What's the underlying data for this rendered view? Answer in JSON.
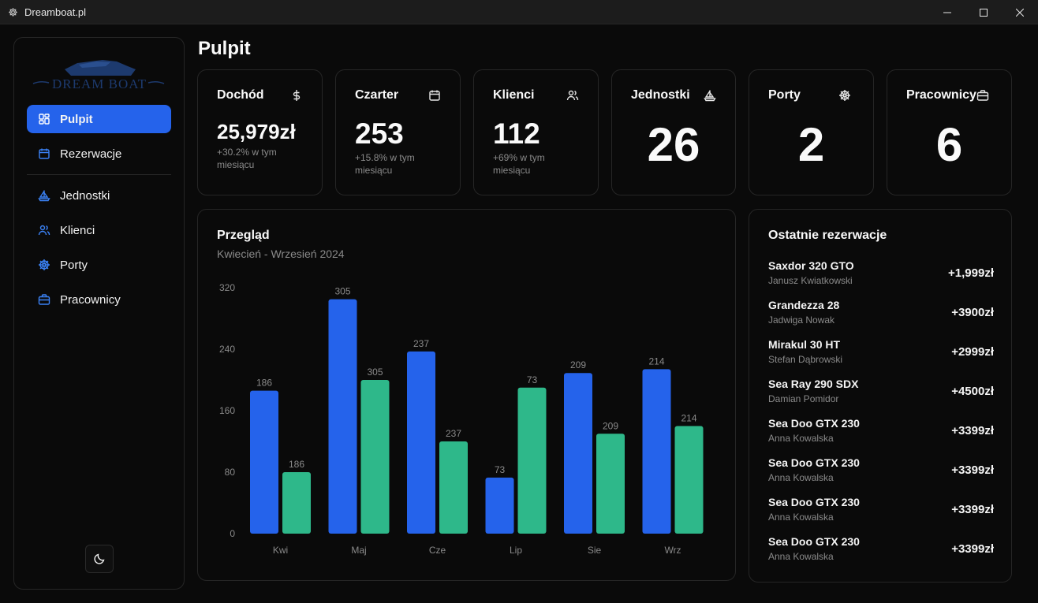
{
  "window": {
    "title": "Dreamboat.pl"
  },
  "sidebar": {
    "logo_text": "DREAM BOAT",
    "items": [
      {
        "label": "Pulpit",
        "icon": "dashboard-grid-icon",
        "active": true
      },
      {
        "label": "Rezerwacje",
        "icon": "calendar-icon",
        "active": false
      },
      {
        "label": "Jednostki",
        "icon": "sailboat-icon",
        "active": false
      },
      {
        "label": "Klienci",
        "icon": "users-icon",
        "active": false
      },
      {
        "label": "Porty",
        "icon": "ship-wheel-icon",
        "active": false
      },
      {
        "label": "Pracownicy",
        "icon": "briefcase-icon",
        "active": false
      }
    ],
    "theme_toggle_icon": "moon-icon"
  },
  "page": {
    "title": "Pulpit"
  },
  "cards": [
    {
      "title": "Dochód",
      "value": "25,979zł",
      "sub": "+30.2% w tym miesiącu",
      "icon": "dollar-icon"
    },
    {
      "title": "Czarter",
      "value": "253",
      "sub": "+15.8% w tym miesiącu",
      "icon": "calendar-icon"
    },
    {
      "title": "Klienci",
      "value": "112",
      "sub": "+69% w tym miesiącu",
      "icon": "users-icon"
    },
    {
      "title": "Jednostki",
      "value": "26",
      "icon": "sailboat-icon"
    },
    {
      "title": "Porty",
      "value": "2",
      "icon": "ship-wheel-icon"
    },
    {
      "title": "Pracownicy",
      "value": "6",
      "icon": "briefcase-icon"
    }
  ],
  "overview": {
    "title": "Przegląd",
    "subtitle": "Kwiecień - Wrzesień 2024"
  },
  "chart_data": {
    "type": "bar",
    "title": "Przegląd",
    "subtitle": "Kwiecień - Wrzesień 2024",
    "categories": [
      "Kwi",
      "Maj",
      "Cze",
      "Lip",
      "Sie",
      "Wrz"
    ],
    "series": [
      {
        "values": [
          186,
          305,
          237,
          73,
          209,
          214
        ],
        "color": "#2563eb"
      },
      {
        "values": [
          80,
          200,
          120,
          190,
          130,
          140
        ],
        "labels": [
          "186",
          "305",
          "237",
          "73",
          "209",
          "214"
        ],
        "color": "#2eb88a"
      }
    ],
    "y_ticks": [
      "0",
      "80",
      "160",
      "240",
      "320"
    ],
    "ylim": [
      0,
      320
    ],
    "grid": false,
    "legend": "none"
  },
  "recent": {
    "title": "Ostatnie rezerwacje",
    "items": [
      {
        "boat": "Saxdor 320 GTO",
        "client": "Janusz Kwiatkowski",
        "amount": "+1,999zł"
      },
      {
        "boat": "Grandezza 28",
        "client": "Jadwiga Nowak",
        "amount": "+3900zł"
      },
      {
        "boat": "Mirakul 30 HT",
        "client": "Stefan Dąbrowski",
        "amount": "+2999zł"
      },
      {
        "boat": "Sea Ray 290 SDX",
        "client": "Damian Pomidor",
        "amount": "+4500zł"
      },
      {
        "boat": "Sea Doo GTX 230",
        "client": "Anna Kowalska",
        "amount": "+3399zł"
      },
      {
        "boat": "Sea Doo GTX 230",
        "client": "Anna Kowalska",
        "amount": "+3399zł"
      },
      {
        "boat": "Sea Doo GTX 230",
        "client": "Anna Kowalska",
        "amount": "+3399zł"
      },
      {
        "boat": "Sea Doo GTX 230",
        "client": "Anna Kowalska",
        "amount": "+3399zł"
      }
    ]
  }
}
